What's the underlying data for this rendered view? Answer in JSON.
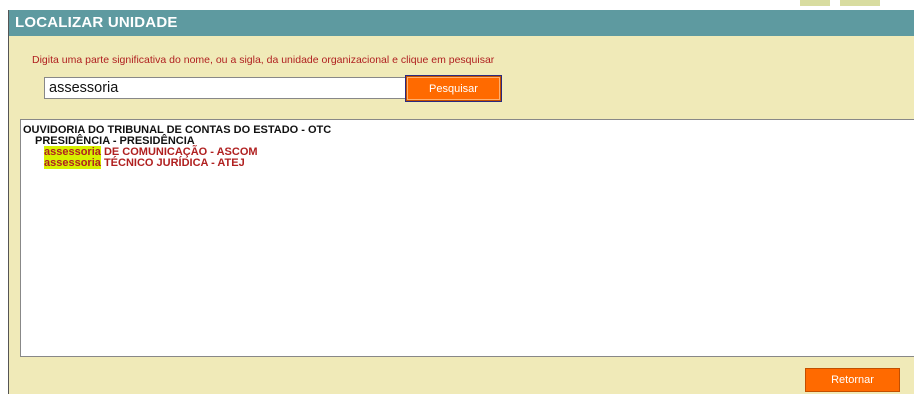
{
  "dialog": {
    "title": "LOCALIZAR UNIDADE",
    "instruction": "Digita uma parte significativa do nome, ou a sigla, da unidade organizacional e clique em pesquisar",
    "search_value": "assessoria",
    "search_button_label": "Pesquisar",
    "return_button_label": "Retornar"
  },
  "results": {
    "root": "OUVIDORIA DO TRIBUNAL DE CONTAS DO ESTADO - OTC",
    "parent": "PRESIDÊNCIA - PRESIDÊNCIA",
    "items": [
      {
        "highlight": "assessoria",
        "rest": " DE COMUNICAÇÃO - ASCOM"
      },
      {
        "highlight": "assessoria",
        "rest": " TÉCNICO JURÍDICA - ATEJ"
      }
    ]
  },
  "colors": {
    "titlebar": "#5e9aa0",
    "panel_bg": "#f0eab8",
    "button": "#ff6a00",
    "instruction_text": "#b02020",
    "result_text": "#b02020",
    "highlight": "#d8f000"
  }
}
